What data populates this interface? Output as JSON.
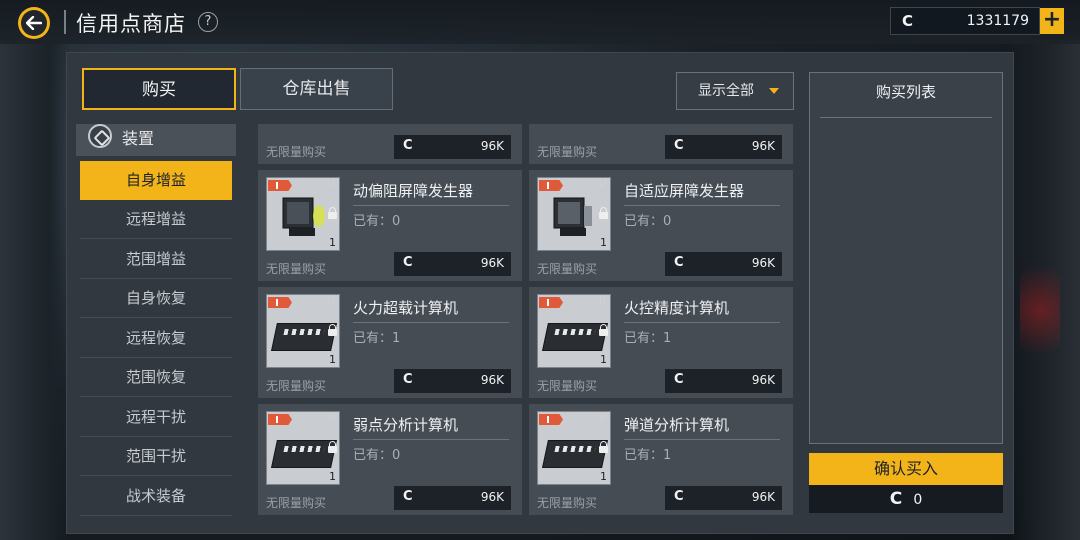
{
  "header": {
    "title": "信用点商店",
    "help_label": "?",
    "currency_symbol": "C",
    "currency_value": "1331179",
    "add_label": "+"
  },
  "tabs": [
    {
      "label": "购买",
      "active": true
    },
    {
      "label": "仓库出售",
      "active": false
    }
  ],
  "filter": {
    "selected": "显示全部"
  },
  "sidebar": {
    "category": "装置",
    "items": [
      {
        "label": "自身增益",
        "active": true
      },
      {
        "label": "远程增益"
      },
      {
        "label": "范围增益"
      },
      {
        "label": "自身恢复"
      },
      {
        "label": "远程恢复"
      },
      {
        "label": "范围恢复"
      },
      {
        "label": "远程干扰"
      },
      {
        "label": "范围干扰"
      },
      {
        "label": "战术装备"
      }
    ]
  },
  "items": [
    {
      "name": "",
      "owned": "",
      "limit": "无限量购买",
      "price_symbol": "C",
      "price": "96K",
      "partial": true
    },
    {
      "name": "",
      "owned": "",
      "limit": "无限量购买",
      "price_symbol": "C",
      "price": "96K",
      "partial": true
    },
    {
      "name": "动偏阻屏障发生器",
      "owned": "已有：0",
      "limit": "无限量购买",
      "price_symbol": "C",
      "price": "96K",
      "qty": "1",
      "badge": "U",
      "icon": "shield-generator-icon"
    },
    {
      "name": "自适应屏障发生器",
      "owned": "已有：0",
      "limit": "无限量购买",
      "price_symbol": "C",
      "price": "96K",
      "qty": "1",
      "badge": "U",
      "icon": "shield-generator-icon"
    },
    {
      "name": "火力超载计算机",
      "owned": "已有：1",
      "limit": "无限量购买",
      "price_symbol": "C",
      "price": "96K",
      "qty": "1",
      "badge": "U",
      "icon": "computer-module-icon"
    },
    {
      "name": "火控精度计算机",
      "owned": "已有：1",
      "limit": "无限量购买",
      "price_symbol": "C",
      "price": "96K",
      "qty": "1",
      "badge": "U",
      "icon": "computer-module-icon"
    },
    {
      "name": "弱点分析计算机",
      "owned": "已有：0",
      "limit": "无限量购买",
      "price_symbol": "C",
      "price": "96K",
      "qty": "1",
      "badge": "U",
      "icon": "computer-module-icon"
    },
    {
      "name": "弹道分析计算机",
      "owned": "已有：1",
      "limit": "无限量购买",
      "price_symbol": "C",
      "price": "96K",
      "qty": "1",
      "badge": "U",
      "icon": "computer-module-icon"
    }
  ],
  "purchase_list": {
    "title": "购买列表",
    "confirm_label": "确认买入",
    "total_symbol": "C",
    "total_value": "0"
  },
  "colors": {
    "accent": "#f3b41a",
    "panel": "#313840",
    "card": "#454c54"
  }
}
